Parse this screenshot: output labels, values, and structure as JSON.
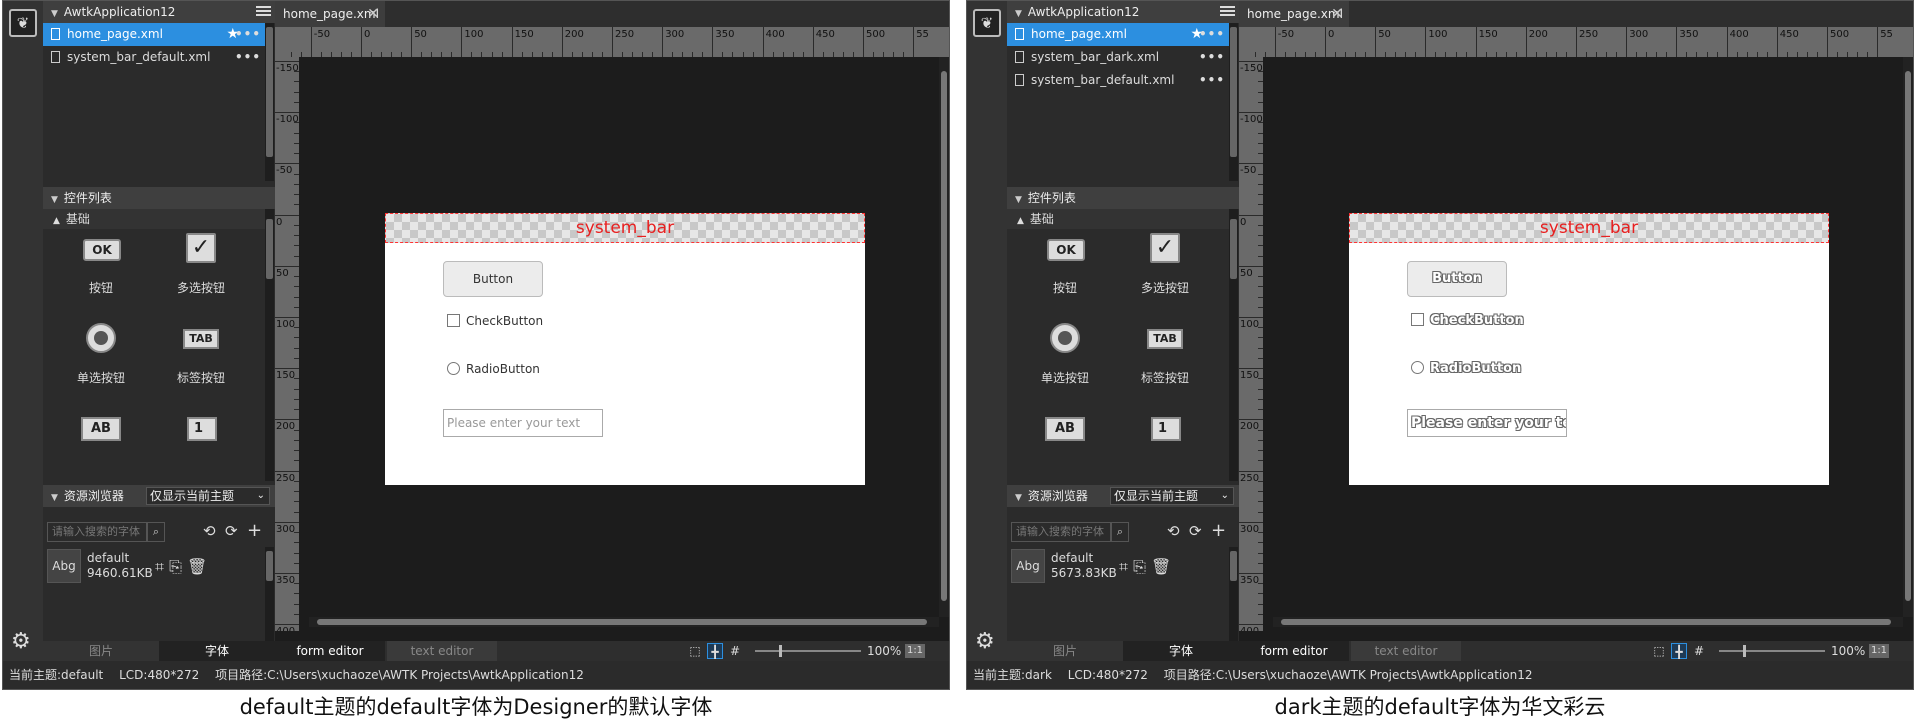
{
  "panels": [
    {
      "theme_class": "default",
      "project_title": "AwtkApplication12",
      "files": [
        {
          "name": "home_page.xml",
          "selected": true
        },
        {
          "name": "system_bar_default.xml",
          "selected": false
        }
      ],
      "widget_list_title": "控件列表",
      "category": "基础",
      "widgets": [
        {
          "icon": "ok-button-icon",
          "glyph": "OK",
          "label": "按钮"
        },
        {
          "icon": "check-button-icon",
          "glyph": "✓",
          "label": "多选按钮"
        },
        {
          "icon": "radio-button-icon",
          "glyph": "",
          "label": "单选按钮"
        },
        {
          "icon": "tab-button-icon",
          "glyph": "TAB",
          "label": "标签按钮"
        },
        {
          "icon": "edit-icon",
          "glyph": "AB",
          "label": ""
        },
        {
          "icon": "spin-box-icon",
          "glyph": "1",
          "label": ""
        }
      ],
      "resource_browser_title": "资源浏览器",
      "resource_filter": "仅显示当前主题",
      "search_placeholder": "请输入搜索的字体",
      "resource": {
        "preview": "Abg",
        "name": "default",
        "size": "9460.61KB"
      },
      "bottom_tabs": [
        "图片",
        "字体"
      ],
      "doc_tab": "home_page.xml",
      "system_bar_text": "system_bar",
      "button_text": "Button",
      "check_text": "CheckButton",
      "radio_text": "RadioButton",
      "edit_placeholder": "Please enter your text",
      "editor_tabs": [
        "form editor",
        "text editor"
      ],
      "zoom": "100%",
      "ratio": "1:1",
      "status": {
        "theme": "当前主题:default",
        "lcd": "LCD:480*272",
        "path": "项目路径:C:\\Users\\xuchaoze\\AWTK Projects\\AwtkApplication12"
      },
      "caption": "default主题的default字体为Designer的默认字体"
    },
    {
      "theme_class": "dark",
      "project_title": "AwtkApplication12",
      "files": [
        {
          "name": "home_page.xml",
          "selected": true
        },
        {
          "name": "system_bar_dark.xml",
          "selected": false
        },
        {
          "name": "system_bar_default.xml",
          "selected": false
        }
      ],
      "widget_list_title": "控件列表",
      "category": "基础",
      "widgets": [
        {
          "icon": "ok-button-icon",
          "glyph": "OK",
          "label": "按钮"
        },
        {
          "icon": "check-button-icon",
          "glyph": "✓",
          "label": "多选按钮"
        },
        {
          "icon": "radio-button-icon",
          "glyph": "",
          "label": "单选按钮"
        },
        {
          "icon": "tab-button-icon",
          "glyph": "TAB",
          "label": "标签按钮"
        },
        {
          "icon": "edit-icon",
          "glyph": "AB",
          "label": ""
        },
        {
          "icon": "spin-box-icon",
          "glyph": "1",
          "label": ""
        }
      ],
      "resource_browser_title": "资源浏览器",
      "resource_filter": "仅显示当前主题",
      "search_placeholder": "请输入搜索的字体",
      "resource": {
        "preview": "Abg",
        "name": "default",
        "size": "5673.83KB"
      },
      "bottom_tabs": [
        "图片",
        "字体"
      ],
      "doc_tab": "home_page.xml",
      "system_bar_text": "system_bar",
      "button_text": "Button",
      "check_text": "CheckButton",
      "radio_text": "RadioButton",
      "edit_placeholder": "Please enter your te",
      "editor_tabs": [
        "form editor",
        "text editor"
      ],
      "zoom": "100%",
      "ratio": "1:1",
      "status": {
        "theme": "当前主题:dark",
        "lcd": "LCD:480*272",
        "path": "项目路径:C:\\Users\\xuchaoze\\AWTK Projects\\AwtkApplication12"
      },
      "caption": "dark主题的default字体为华文彩云"
    }
  ],
  "ruler": {
    "h_labels": [
      "-50",
      "0",
      "50",
      "100",
      "150",
      "200",
      "250",
      "300",
      "350",
      "400",
      "450",
      "500",
      "55"
    ],
    "v_labels": [
      "-150",
      "-100",
      "-50",
      "0",
      "50",
      "100",
      "150",
      "200",
      "250",
      "300",
      "350",
      "400"
    ]
  }
}
